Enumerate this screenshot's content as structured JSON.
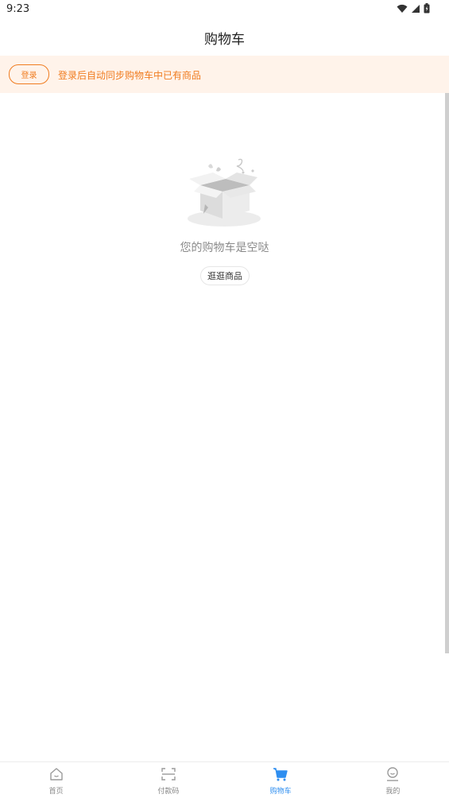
{
  "status_bar": {
    "time": "9:23"
  },
  "nav": {
    "title": "购物车"
  },
  "login_banner": {
    "button_label": "登录",
    "tip": "登录后自动同步购物车中已有商品"
  },
  "empty_state": {
    "message": "您的购物车是空哒",
    "browse_label": "逛逛商品"
  },
  "tabs": [
    {
      "label": "首页",
      "icon": "home-icon",
      "active": false
    },
    {
      "label": "付款码",
      "icon": "scan-icon",
      "active": false
    },
    {
      "label": "购物车",
      "icon": "cart-icon",
      "active": true
    },
    {
      "label": "我的",
      "icon": "profile-icon",
      "active": false
    }
  ],
  "colors": {
    "accent": "#f07c20",
    "banner_bg": "#fff3ea",
    "tab_active": "#2e8ef0"
  }
}
